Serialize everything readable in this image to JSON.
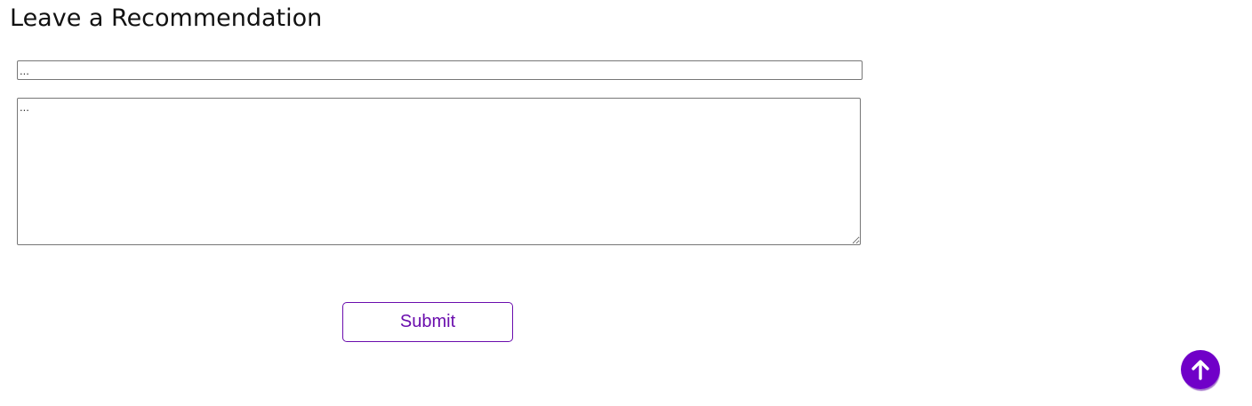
{
  "page": {
    "title": "Leave a Recommendation"
  },
  "form": {
    "name_placeholder": "...",
    "message_placeholder": "...",
    "submit_label": "Submit"
  },
  "scroll_top": {
    "icon": "arrow-up-icon"
  },
  "colors": {
    "accent": "#7000c8",
    "button_border": "#6a0dad"
  }
}
